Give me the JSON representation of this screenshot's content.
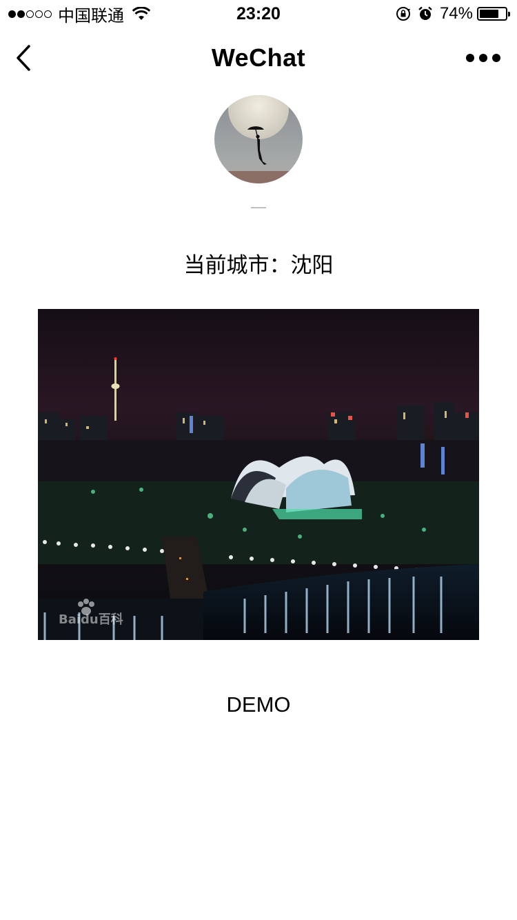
{
  "status_bar": {
    "carrier": "中国联通",
    "time": "23:20",
    "battery_percent": "74%",
    "battery_level": 0.74,
    "signal_bars_filled": 2,
    "signal_bars_total": 5
  },
  "nav": {
    "title": "WeChat",
    "back_icon": "chevron-left-icon",
    "more_icon": "more-dots-icon"
  },
  "profile": {
    "nickname": "—"
  },
  "city": {
    "text": "当前城市：沈阳"
  },
  "image": {
    "description_icon": "city-night-photo",
    "watermark": "Baidu百科"
  },
  "footer": {
    "demo_label": "DEMO"
  }
}
